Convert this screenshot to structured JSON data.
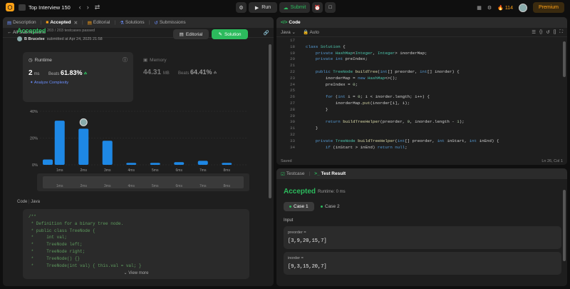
{
  "topbar": {
    "list_title": "Top Interview 150",
    "run": "Run",
    "submit": "Submit",
    "streak": "114",
    "premium": "Premium"
  },
  "left": {
    "tabs": [
      "Description",
      "Accepted",
      "Editorial",
      "Solutions",
      "Submissions"
    ],
    "all_submissions": "All Submissions",
    "status": "Accepted",
    "passed": "203 / 203 testcases passed",
    "author": "B Brucelee",
    "submitted": "submitted at Apr 24, 2025 21:58",
    "editorial_btn": "Editorial",
    "solution_btn": "Solution",
    "runtime": {
      "label": "Runtime",
      "value": "2",
      "unit": "ms",
      "beats_label": "Beats",
      "beats": "61.83%",
      "complexity": "Analyze Complexity"
    },
    "memory": {
      "label": "Memory",
      "value": "44.31",
      "unit": "MB",
      "beats_label": "Beats",
      "beats": "64.41%"
    },
    "code_header": "Code",
    "code_lang": "Java",
    "code_lines": [
      "/**",
      " * Definition for a binary tree node.",
      " * public class TreeNode {",
      " *     int val;",
      " *     TreeNode left;",
      " *     TreeNode right;",
      " *     TreeNode() {}",
      " *     TreeNode(int val) { this.val = val; }"
    ],
    "view_more": "View more"
  },
  "chart_data": {
    "type": "bar",
    "categories": [
      "1ms",
      "2ms",
      "3ms",
      "4ms",
      "5ms",
      "6ms",
      "7ms",
      "8ms"
    ],
    "series": [
      {
        "values": [
          4,
          33,
          27,
          18,
          1.5,
          1.5,
          2,
          3,
          1.5
        ]
      }
    ],
    "x_positions_ms": [
      0.5,
      1,
      2,
      3,
      4,
      5,
      6,
      7,
      8
    ],
    "ylim": [
      0,
      40
    ],
    "yticks": [
      "40%",
      "20%",
      "0%"
    ],
    "highlight_category": "2ms"
  },
  "code_panel": {
    "title": "Code",
    "language": "Java",
    "mode": "Auto",
    "saved": "Saved",
    "cursor": "Ln 26, Col 1",
    "lines": [
      {
        "n": "17",
        "t": ""
      },
      {
        "n": "18",
        "t": "class Solution {"
      },
      {
        "n": "19",
        "t": "    private HashMap<Integer, Integer> inorderMap;"
      },
      {
        "n": "20",
        "t": "    private int preIndex;"
      },
      {
        "n": "21",
        "t": ""
      },
      {
        "n": "22",
        "t": "    public TreeNode buildTree(int[] preorder, int[] inorder) {"
      },
      {
        "n": "23",
        "t": "        inorderMap = new HashMap<>();"
      },
      {
        "n": "24",
        "t": "        preIndex = 0;"
      },
      {
        "n": "25",
        "t": ""
      },
      {
        "n": "26",
        "t": "        for (int i = 0; i < inorder.length; i++) {"
      },
      {
        "n": "27",
        "t": "            inorderMap.put(inorder[i], i);"
      },
      {
        "n": "28",
        "t": "        }"
      },
      {
        "n": "29",
        "t": ""
      },
      {
        "n": "30",
        "t": "        return buildTreeHelper(preorder, 0, inorder.length - 1);"
      },
      {
        "n": "31",
        "t": "    }"
      },
      {
        "n": "32",
        "t": ""
      },
      {
        "n": "33",
        "t": "    private TreeNode buildTreeHelper(int[] preorder, int inStart, int inEnd) {"
      },
      {
        "n": "34",
        "t": "        if (inStart > inEnd) return null;"
      }
    ]
  },
  "test_panel": {
    "tabs": [
      "Testcase",
      "Test Result"
    ],
    "status": "Accepted",
    "runtime": "Runtime: 0 ms",
    "cases": [
      "Case 1",
      "Case 2"
    ],
    "input_label": "Input",
    "inputs": [
      {
        "name": "preorder =",
        "value": "[3,9,20,15,7]"
      },
      {
        "name": "inorder =",
        "value": "[9,3,15,20,7]"
      }
    ]
  },
  "colors": {
    "accent": "#ffa116",
    "success": "#2cbb5d",
    "bar": "#1e88e5"
  }
}
